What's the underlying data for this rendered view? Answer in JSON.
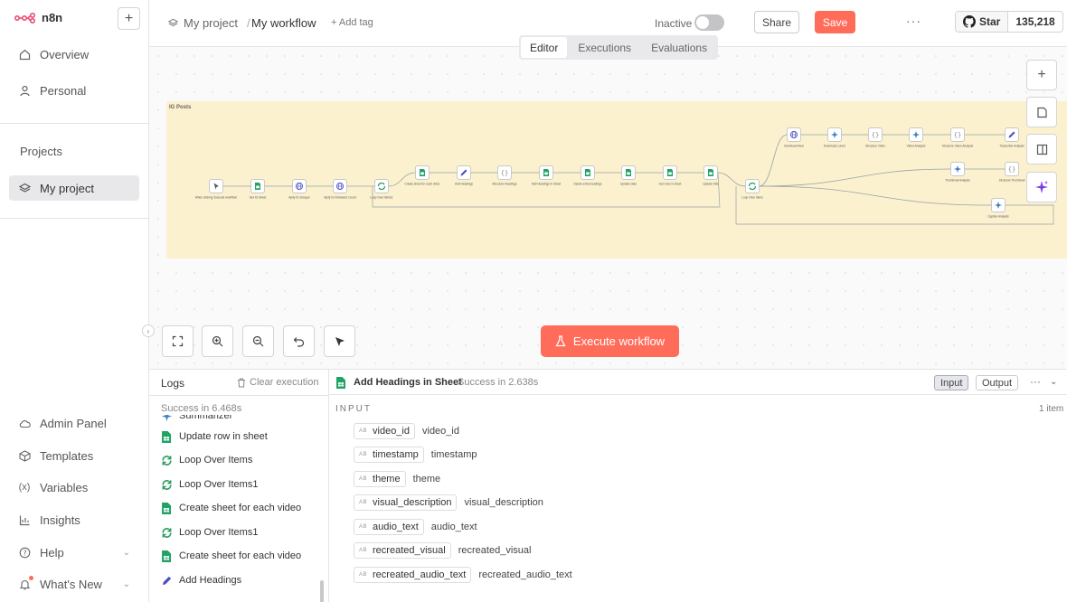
{
  "app": {
    "name": "n8n"
  },
  "sidebar": {
    "nav_top": [
      {
        "label": "Overview",
        "icon": "home-icon"
      },
      {
        "label": "Personal",
        "icon": "user-icon"
      }
    ],
    "projects_title": "Projects",
    "project_item": "My project",
    "nav_bottom": [
      {
        "label": "Admin Panel",
        "icon": "cloud-icon"
      },
      {
        "label": "Templates",
        "icon": "box-icon"
      },
      {
        "label": "Variables",
        "icon": "variable-icon"
      },
      {
        "label": "Insights",
        "icon": "chart-icon"
      },
      {
        "label": "Help",
        "icon": "help-icon"
      },
      {
        "label": "What's New",
        "icon": "bell-icon"
      }
    ]
  },
  "header": {
    "project": "My project",
    "separator": "/",
    "workflow": "My workflow",
    "add_tag": "+ Add tag",
    "status": "Inactive",
    "share": "Share",
    "save": "Save",
    "github_star": "Star",
    "github_count": "135,218"
  },
  "tabs": [
    "Editor",
    "Executions",
    "Evaluations"
  ],
  "canvas": {
    "sticky_title": "IG Posts",
    "execute_button": "Execute workflow",
    "nodes": [
      {
        "label": "When clicking 'Execute workflow'",
        "kind": "manual"
      },
      {
        "label": "Get IG Sheet",
        "kind": "sheets"
      },
      {
        "label": "Apify IG Scraper",
        "kind": "http"
      },
      {
        "label": "Apify IG Followers Count",
        "kind": "http"
      },
      {
        "label": "Loop Over Items1",
        "kind": "loop"
      },
      {
        "label": "Create sheet for each video",
        "kind": "sheets"
      },
      {
        "label": "Add Headings",
        "kind": "edit"
      },
      {
        "label": "Structure Headings",
        "kind": "code"
      },
      {
        "label": "Add Headings in Sheet",
        "kind": "sheets"
      },
      {
        "label": "Delete extra headings",
        "kind": "sheets"
      },
      {
        "label": "Update Data",
        "kind": "sheets"
      },
      {
        "label": "Get rows in sheet",
        "kind": "sheets"
      },
      {
        "label": "Update Vids",
        "kind": "sheets"
      },
      {
        "label": "Loop Over Items",
        "kind": "loop"
      },
      {
        "label": "Download Reel",
        "kind": "http"
      },
      {
        "label": "Download Lorem",
        "kind": "ai"
      },
      {
        "label": "Structure Video",
        "kind": "code"
      },
      {
        "label": "Video Analysis",
        "kind": "ai"
      },
      {
        "label": "Structure Video Analysis",
        "kind": "code"
      },
      {
        "label": "Transcribe Analysis",
        "kind": "edit"
      },
      {
        "label": "Thumbnail Analysis",
        "kind": "ai"
      },
      {
        "label": "Structure Thumbnail",
        "kind": "code"
      },
      {
        "label": "Caption Analysis",
        "kind": "ai"
      }
    ]
  },
  "logs": {
    "title": "Logs",
    "clear": "Clear execution",
    "status": "Success in 6.468s",
    "items": [
      {
        "label": "Summarizer",
        "kind": "ai"
      },
      {
        "label": "Update row in sheet",
        "kind": "sheets"
      },
      {
        "label": "Loop Over Items",
        "kind": "loop"
      },
      {
        "label": "Loop Over Items1",
        "kind": "loop"
      },
      {
        "label": "Create sheet for each video",
        "kind": "sheets"
      },
      {
        "label": "Loop Over Items1",
        "kind": "loop"
      },
      {
        "label": "Create sheet for each video",
        "kind": "sheets"
      },
      {
        "label": "Add Headings",
        "kind": "edit"
      }
    ]
  },
  "node_panel": {
    "name": "Add Headings in Sheet",
    "status": "Success in 2.638s",
    "input_btn": "Input",
    "output_btn": "Output",
    "section": "INPUT",
    "count": "1 item",
    "type_tag": "AB",
    "fields": [
      {
        "key": "video_id",
        "value": "video_id"
      },
      {
        "key": "timestamp",
        "value": "timestamp"
      },
      {
        "key": "theme",
        "value": "theme"
      },
      {
        "key": "visual_description",
        "value": "visual_description"
      },
      {
        "key": "audio_text",
        "value": "audio_text"
      },
      {
        "key": "recreated_visual",
        "value": "recreated_visual"
      },
      {
        "key": "recreated_audio_text",
        "value": "recreated_audio_text"
      }
    ]
  },
  "colors": {
    "accent": "#ff6d5a",
    "sheets": "#21a366",
    "http": "#5b5fc7",
    "loop": "#2e9b5e",
    "edit": "#4b4fc4",
    "ai": "#3b82c4",
    "sticky": "#fbf1ce"
  }
}
